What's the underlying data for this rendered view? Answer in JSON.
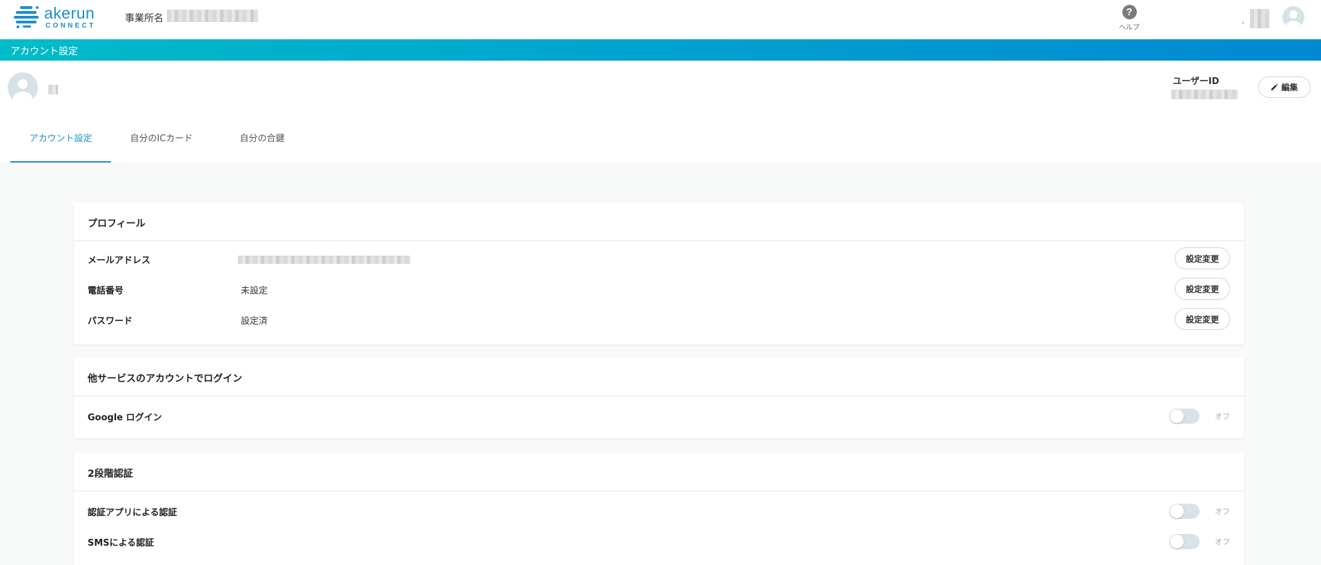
{
  "header": {
    "logo_word": "akerun",
    "logo_sub": "CONNECT",
    "office_label": "事業所名",
    "help_label": "ヘルプ",
    "help_icon": "question-circle-icon",
    "user_menu_chevron": "›"
  },
  "titlebar": {
    "title": "アカウント設定"
  },
  "profile": {
    "user_id_label": "ユーザーID",
    "edit_label": "編集",
    "edit_icon": "pencil-icon"
  },
  "tabs": [
    {
      "label": "アカウント設定",
      "active": true
    },
    {
      "label": "自分のICカード",
      "active": false
    },
    {
      "label": "自分の合鍵",
      "active": false
    }
  ],
  "profile_card": {
    "title": "プロフィール",
    "rows": [
      {
        "label": "メールアドレス",
        "value": "",
        "button": "設定変更"
      },
      {
        "label": "電話番号",
        "value": "未設定",
        "button": "設定変更"
      },
      {
        "label": "パスワード",
        "value": "設定済",
        "button": "設定変更"
      }
    ]
  },
  "social_card": {
    "title": "他サービスのアカウントでログイン",
    "rows": [
      {
        "label": "Google ログイン",
        "state": "オフ",
        "on": false
      }
    ]
  },
  "twofa_card": {
    "title": "2段階認証",
    "rows": [
      {
        "label": "認証アプリによる認証",
        "state": "オフ",
        "on": false
      },
      {
        "label": "SMSによる認証",
        "state": "オフ",
        "on": false
      }
    ]
  },
  "colors": {
    "accent": "#1d8ecb",
    "gradient_start": "#00bcc8",
    "gradient_end": "#0089d2"
  }
}
